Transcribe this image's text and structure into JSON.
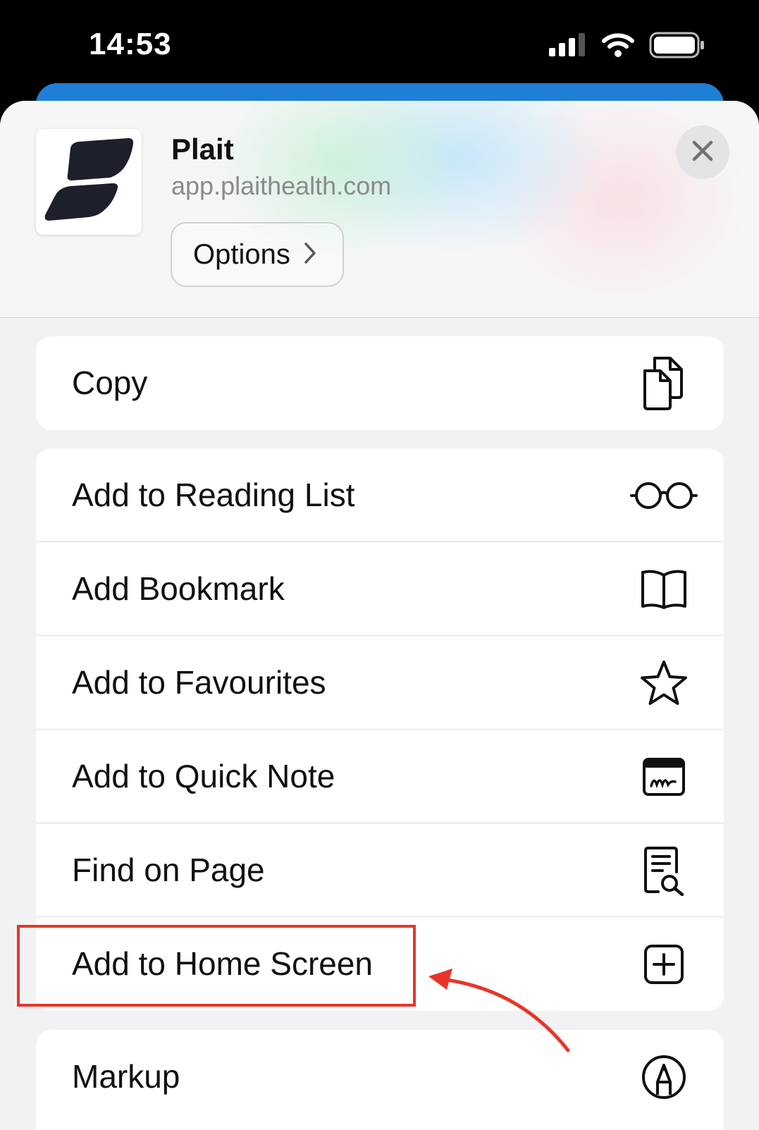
{
  "status_bar": {
    "time": "14:53"
  },
  "header": {
    "app_name": "Plait",
    "app_url": "app.plaithealth.com",
    "options_label": "Options"
  },
  "colors": {
    "accent_blue": "#1f7ed6",
    "highlight_red": "#e8352a"
  },
  "actions": {
    "copy": {
      "label": "Copy",
      "icon": "copy-icon"
    },
    "items": [
      {
        "label": "Add to Reading List",
        "icon": "glasses-icon"
      },
      {
        "label": "Add Bookmark",
        "icon": "book-icon"
      },
      {
        "label": "Add to Favourites",
        "icon": "star-icon"
      },
      {
        "label": "Add to Quick Note",
        "icon": "quick-note-icon"
      },
      {
        "label": "Find on Page",
        "icon": "find-on-page-icon"
      },
      {
        "label": "Add to Home Screen",
        "icon": "plus-square-icon"
      }
    ],
    "markup": {
      "label": "Markup",
      "icon": "markup-pen-icon"
    }
  }
}
